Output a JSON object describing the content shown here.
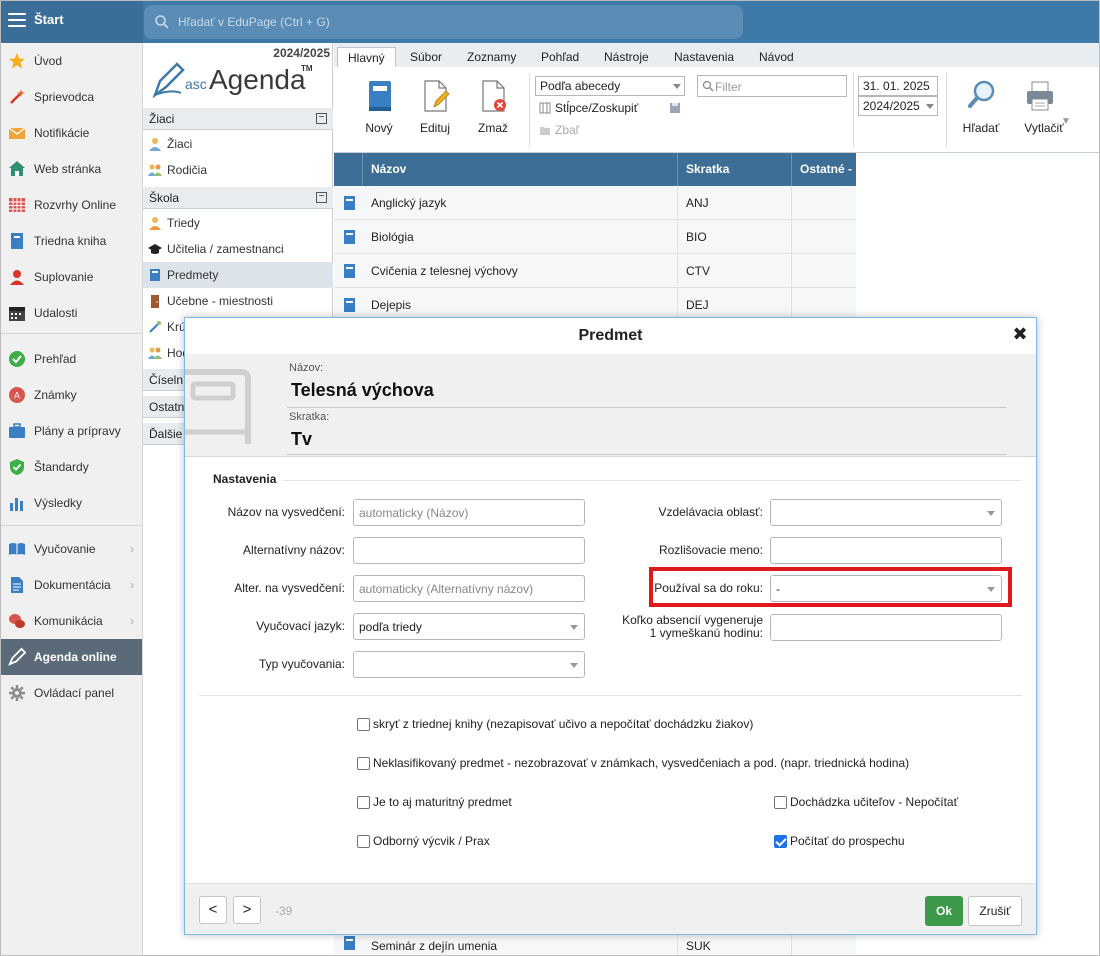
{
  "topbar": {
    "title": "Štart",
    "search_placeholder": "Hľadať v EduPage (Ctrl + G)"
  },
  "leftnav": {
    "items": [
      {
        "label": "Úvod",
        "icon": "star-icon"
      },
      {
        "label": "Sprievodca",
        "icon": "magic-wand-icon"
      },
      {
        "label": "Notifikácie",
        "icon": "envelope-icon"
      },
      {
        "label": "Web stránka",
        "icon": "house-icon"
      },
      {
        "label": "Rozvrhy Online",
        "icon": "timetable-grid-icon"
      },
      {
        "label": "Triedna kniha",
        "icon": "class-book-icon"
      },
      {
        "label": "Suplovanie",
        "icon": "substitute-person-icon"
      },
      {
        "label": "Udalosti",
        "icon": "calendar-icon"
      },
      {
        "label": "Prehľad",
        "icon": "check-circle-icon"
      },
      {
        "label": "Známky",
        "icon": "grade-badge-icon"
      },
      {
        "label": "Plány a prípravy",
        "icon": "briefcase-icon"
      },
      {
        "label": "Štandardy",
        "icon": "shield-check-icon"
      },
      {
        "label": "Výsledky",
        "icon": "bar-chart-icon"
      },
      {
        "label": "Vyučovanie",
        "icon": "open-book-icon"
      },
      {
        "label": "Dokumentácia",
        "icon": "document-icon"
      },
      {
        "label": "Komunikácia",
        "icon": "chat-bubbles-icon"
      },
      {
        "label": "Agenda online",
        "icon": "pencil-icon"
      },
      {
        "label": "Ovládací panel",
        "icon": "gear-icon"
      }
    ]
  },
  "agenda": {
    "year": "2024/2025",
    "logo_prefix": "asc",
    "logo_name": "Agenda",
    "logo_tm": "TM",
    "sections": {
      "ziaci": "Žiaci",
      "skola": "Škola",
      "ciselniky": "Číseln",
      "ostatne": "Ostatn",
      "dalsie": "Ďalšie"
    },
    "items": {
      "ziaci": "Žiaci",
      "rodicia": "Rodičia",
      "triedy": "Triedy",
      "ucitelia": "Učitelia / zamestnanci",
      "predmety": "Predmety",
      "ucebne": "Učebne - miestnosti",
      "kruzky": "Krú",
      "hodiny": "Hod"
    }
  },
  "ribbon": {
    "tabs": [
      "Hlavný",
      "Súbor",
      "Zoznamy",
      "Pohľad",
      "Nástroje",
      "Nastavenia",
      "Návod"
    ],
    "new_label": "Nový",
    "edit_label": "Edituj",
    "delete_label": "Zmaž",
    "sort_value": "Podľa abecedy",
    "columns_label": "Stĺpce/Zoskupiť",
    "collapse_label": "Zbaľ",
    "filter_placeholder": "Filter",
    "date_value": "31. 01. 2025",
    "year_value": "2024/2025",
    "find_label": "Hľadať",
    "print_label": "Vytlačiť"
  },
  "table": {
    "headers": {
      "name": "Názov",
      "short": "Skratka",
      "other": "Ostatné -"
    },
    "rows": [
      {
        "name": "Anglický jazyk",
        "short": "ANJ"
      },
      {
        "name": "Biológia",
        "short": "BIO"
      },
      {
        "name": "Cvičenia z telesnej výchovy",
        "short": "CTV"
      },
      {
        "name": "Dejepis",
        "short": "DEJ"
      }
    ],
    "bottom_row": {
      "name": "Seminár z dejín umenia",
      "short": "SUK"
    }
  },
  "dialog": {
    "title": "Predmet",
    "name_label": "Názov:",
    "name_value": "Telesná výchova",
    "short_label": "Skratka:",
    "short_value": "Tv",
    "group_title": "Nastavenia",
    "fields": {
      "report_name_label": "Názov na vysvedčení:",
      "report_name_placeholder": "automaticky (Názov)",
      "alt_name_label": "Alternatívny názov:",
      "alt_report_label": "Alter. na vysvedčení:",
      "alt_report_placeholder": "automaticky (Alternatívny názov)",
      "language_label": "Vyučovací jazyk:",
      "language_value": "podľa triedy",
      "teaching_type_label": "Typ vyučovania:",
      "edu_area_label": "Vzdelávacia oblasť:",
      "distinct_name_label": "Rozlišovacie meno:",
      "used_until_label": "Používal sa do roku:",
      "used_until_value": "-",
      "absences_label_1": "Koľko absencií vygeneruje",
      "absences_label_2": "1 vymeškanú hodinu:"
    },
    "checkboxes": {
      "hide_classbook": "skryť z triednej knihy (nezapisovať učivo a nepočítať dochádzku žiakov)",
      "unclassified": "Neklasifikovaný predmet - nezobrazovať v známkach, vysvedčeniach a pod. (napr. triednická hodina)",
      "maturita": "Je to aj maturitný predmet",
      "teacher_attendance": "Dochádzka učiteľov - Nepočítať",
      "vocational": "Odborný výcvik / Prax",
      "count_progress": "Počítať do prospechu"
    },
    "footer": {
      "prev": "<",
      "next": ">",
      "counter": "-39",
      "ok": "Ok",
      "cancel": "Zrušiť"
    }
  },
  "colors": {
    "topbar": "#3f79a8",
    "table_header": "#3d6e95",
    "ok_button": "#3d9a4a",
    "highlight": "#e0191e",
    "checkbox": "#1a73e8"
  }
}
